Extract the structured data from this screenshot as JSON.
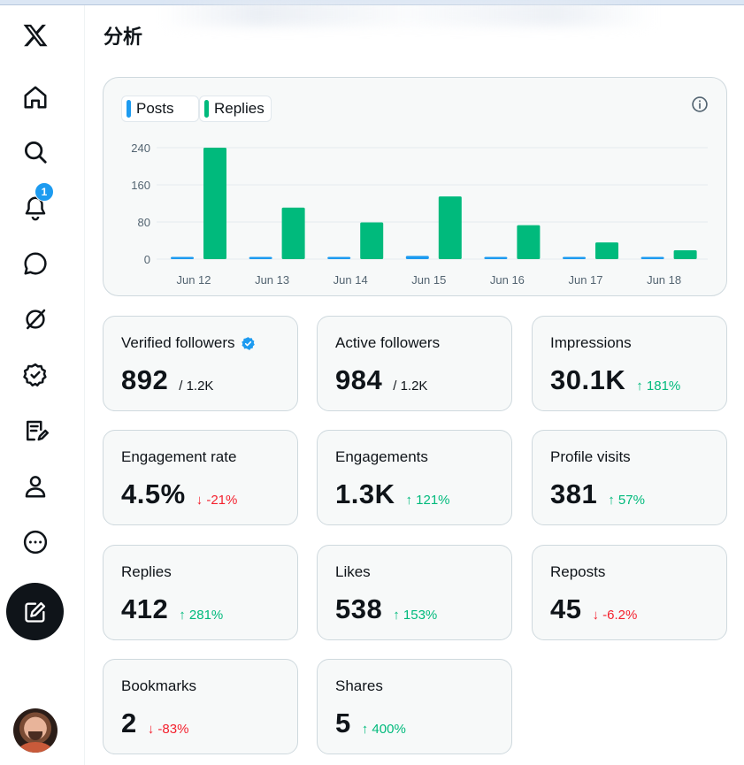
{
  "page": {
    "title": "分析"
  },
  "nav": {
    "items": [
      "x-logo",
      "home",
      "explore",
      "notifications",
      "messages",
      "grok",
      "verified",
      "lists",
      "profile",
      "more"
    ],
    "notification_count": "1"
  },
  "chart": {
    "legend": [
      {
        "label": "Posts",
        "color": "#1d9bf0"
      },
      {
        "label": "Replies",
        "color": "#00ba7c"
      }
    ]
  },
  "chart_data": {
    "type": "bar",
    "categories": [
      "Jun 12",
      "Jun 13",
      "Jun 14",
      "Jun 15",
      "Jun 16",
      "Jun 17",
      "Jun 18"
    ],
    "series": [
      {
        "name": "Posts",
        "color": "#1d9bf0",
        "values": [
          4,
          2,
          3,
          7,
          3,
          3,
          2
        ]
      },
      {
        "name": "Replies",
        "color": "#00ba7c",
        "values": [
          240,
          111,
          79,
          135,
          73,
          36,
          19
        ]
      }
    ],
    "yticks": [
      "0",
      "80",
      "160",
      "240"
    ],
    "ylim": [
      0,
      240
    ],
    "grid": true,
    "legend_position": "top-left"
  },
  "stats": [
    {
      "label": "Verified followers",
      "value": "892",
      "extra": "/ 1.2K",
      "trend": "none",
      "verified": true
    },
    {
      "label": "Active followers",
      "value": "984",
      "extra": "/ 1.2K",
      "trend": "none"
    },
    {
      "label": "Impressions",
      "value": "30.1K",
      "extra": "↑ 181%",
      "trend": "up"
    },
    {
      "label": "Engagement rate",
      "value": "4.5%",
      "extra": "↓ -21%",
      "trend": "down"
    },
    {
      "label": "Engagements",
      "value": "1.3K",
      "extra": "↑ 121%",
      "trend": "up"
    },
    {
      "label": "Profile visits",
      "value": "381",
      "extra": "↑ 57%",
      "trend": "up"
    },
    {
      "label": "Replies",
      "value": "412",
      "extra": "↑ 281%",
      "trend": "up"
    },
    {
      "label": "Likes",
      "value": "538",
      "extra": "↑ 153%",
      "trend": "up"
    },
    {
      "label": "Reposts",
      "value": "45",
      "extra": "↓ -6.2%",
      "trend": "down"
    },
    {
      "label": "Bookmarks",
      "value": "2",
      "extra": "↓ -83%",
      "trend": "down"
    },
    {
      "label": "Shares",
      "value": "5",
      "extra": "↑ 400%",
      "trend": "up"
    }
  ]
}
